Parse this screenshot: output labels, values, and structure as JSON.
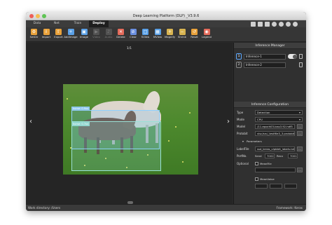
{
  "window": {
    "title": "Deep Learning Platform (DLP) _V3.9.6"
  },
  "tabs": [
    {
      "label": "Data"
    },
    {
      "label": "Net"
    },
    {
      "label": "Train"
    },
    {
      "label": "Deploy"
    }
  ],
  "toolbar": {
    "items": [
      {
        "label": "SetDir",
        "icon": "folder-gear-icon",
        "enabled": true,
        "color": "#e9a23b"
      },
      {
        "label": "Import",
        "icon": "folder-import-icon",
        "enabled": true,
        "color": "#e9a23b"
      },
      {
        "label": "Export",
        "icon": "folder-export-icon",
        "enabled": true,
        "color": "#e9a23b"
      },
      {
        "label": "AddImage",
        "icon": "camera-add-icon",
        "enabled": true,
        "color": "#5aa0e6"
      },
      {
        "label": "Image",
        "icon": "image-icon",
        "enabled": true,
        "color": "#5aa0e6"
      },
      {
        "label": "Video",
        "icon": "video-icon",
        "enabled": false,
        "color": "#888888"
      },
      {
        "label": "Audio",
        "icon": "audio-icon",
        "enabled": false,
        "color": "#888888"
      },
      {
        "label": "Delete",
        "icon": "delete-icon",
        "enabled": true,
        "color": "#e56b5b"
      },
      {
        "label": "Clear",
        "icon": "clear-icon",
        "enabled": true,
        "color": "#6a8fe0"
      },
      {
        "label": "SView",
        "icon": "single-view-icon",
        "enabled": true,
        "color": "#5aa0e6"
      },
      {
        "label": "MView",
        "icon": "multi-view-icon",
        "enabled": true,
        "color": "#5aa0e6"
      },
      {
        "label": "Magnify",
        "icon": "magnify-icon",
        "enabled": true,
        "color": "#d8b451"
      },
      {
        "label": "Shrink",
        "icon": "shrink-icon",
        "enabled": true,
        "color": "#d8b451"
      },
      {
        "label": "Reset",
        "icon": "reset-icon",
        "enabled": true,
        "color": "#e9a23b"
      },
      {
        "label": "Legend",
        "icon": "legend-icon",
        "enabled": true,
        "color": "#e56b5b"
      }
    ]
  },
  "canvas": {
    "page_indicator": "1/1",
    "detections": [
      {
        "label": "horse: 0.9xx"
      },
      {
        "label": "horse: 0.7xx"
      }
    ]
  },
  "inference_manager": {
    "title": "Inference Manager",
    "items": [
      {
        "index": "1",
        "name": "Inference-1",
        "enabled": true
      },
      {
        "index": "2",
        "name": "Inference-2",
        "enabled": false
      }
    ]
  },
  "inference_config": {
    "title": "Inference Configuration",
    "type_label": "Type",
    "type_value": "Detection",
    "mode_label": "Mode",
    "mode_value": "CPU",
    "model_label": "Model",
    "model_value": "/11-epoch03-loss3.92.hdf5",
    "protobit_label": "Protobit",
    "protobit_value": "vlsc/src/_testfile3_3.protobit",
    "parameters_label": "Parameters",
    "labelfile_label": "LabelFile",
    "labelfile_value": "ssd_keras_vlpbtet_labels.txt",
    "portno_label": "PortNo.",
    "send_label": "Send",
    "send_value": "7002",
    "recv_label": "Recv",
    "recv_value": "7001",
    "optional_label": "Optional",
    "meanfile_label": "MeanFile",
    "meanvalue_label": "MeanValue"
  },
  "status": {
    "work_dir": "Work directory: /Users",
    "framework": "Framework: Keras"
  }
}
